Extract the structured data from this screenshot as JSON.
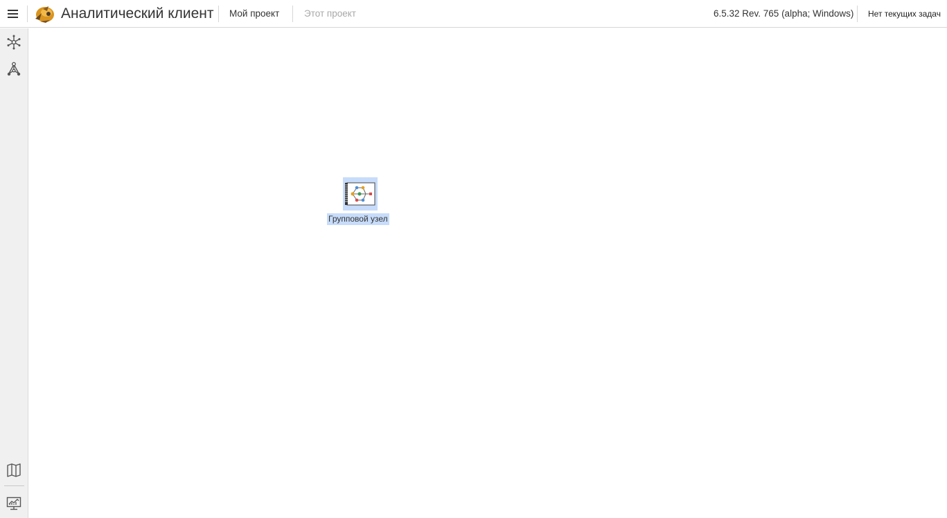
{
  "header": {
    "app_title": "Аналитический клиент",
    "nav": {
      "my_project": "Мой проект",
      "this_project": "Этот проект"
    },
    "version": "6.5.32 Rev. 765 (alpha; Windows)",
    "tasks_status": "Нет текущих задач"
  },
  "sidebar": {
    "items": [
      {
        "icon": "snowflake-node-icon"
      },
      {
        "icon": "workflow-tree-icon"
      },
      {
        "icon": "map-icon"
      },
      {
        "icon": "monitor-chart-icon"
      }
    ]
  },
  "canvas": {
    "nodes": [
      {
        "label": "Групповой узел",
        "icon": "group-node-icon",
        "selected": true
      }
    ]
  },
  "colors": {
    "selection": "#c7dcfa",
    "sidebar_bg": "#f0f0f0",
    "text": "#333333",
    "disabled_text": "#a8a8a8"
  }
}
